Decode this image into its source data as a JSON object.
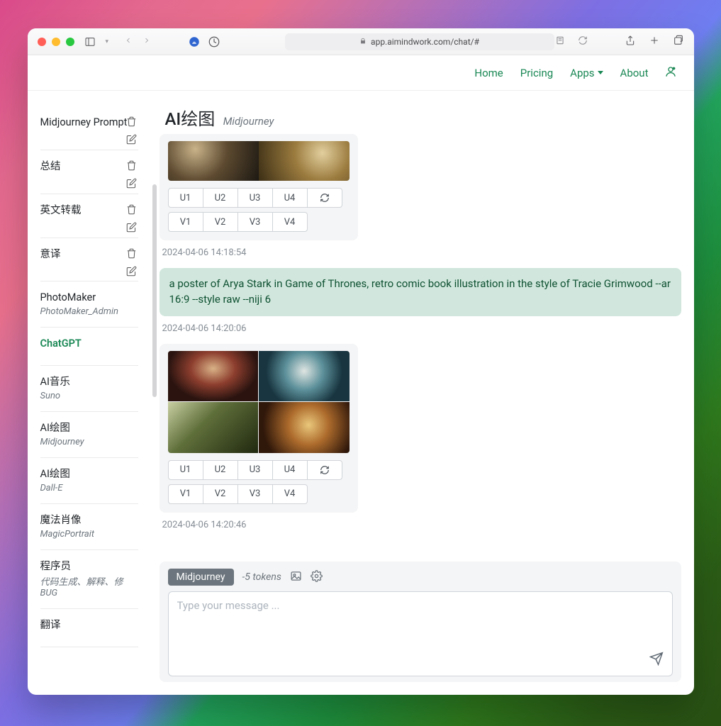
{
  "browser": {
    "url": "app.aimindwork.com/chat/#"
  },
  "nav": {
    "home": "Home",
    "pricing": "Pricing",
    "apps": "Apps",
    "about": "About"
  },
  "header": {
    "title": "AI绘图",
    "subtitle": "Midjourney"
  },
  "sidebar": {
    "items": [
      {
        "title": "Midjourney Prompt",
        "editable": true
      },
      {
        "title": "总结",
        "editable": true
      },
      {
        "title": "英文转载",
        "editable": true
      },
      {
        "title": "意译",
        "editable": true
      },
      {
        "title": "PhotoMaker",
        "sub": "PhotoMaker_Admin"
      },
      {
        "title": "ChatGPT",
        "active": true
      },
      {
        "title": "AI音乐",
        "sub": "Suno"
      },
      {
        "title": "AI绘图",
        "sub": "Midjourney"
      },
      {
        "title": "AI绘图",
        "sub": "Dall-E"
      },
      {
        "title": "魔法肖像",
        "sub": "MagicPortrait"
      },
      {
        "title": "程序员",
        "sub": "代码生成、解释、修BUG"
      },
      {
        "title": "翻译"
      }
    ]
  },
  "mj_buttons": {
    "u1": "U1",
    "u2": "U2",
    "u3": "U3",
    "u4": "U4",
    "v1": "V1",
    "v2": "V2",
    "v3": "V3",
    "v4": "V4"
  },
  "messages": {
    "ts1": "2024-04-06 14:18:54",
    "user_prompt": "a poster of Arya Stark in Game of Thrones, retro comic book illustration in the style of Tracie Grimwood --ar 16:9 --style raw --niji 6",
    "ts2": "2024-04-06 14:20:06",
    "ts3": "2024-04-06 14:20:46"
  },
  "composer": {
    "model": "Midjourney",
    "cost": "-5 tokens",
    "placeholder": "Type your message ..."
  }
}
